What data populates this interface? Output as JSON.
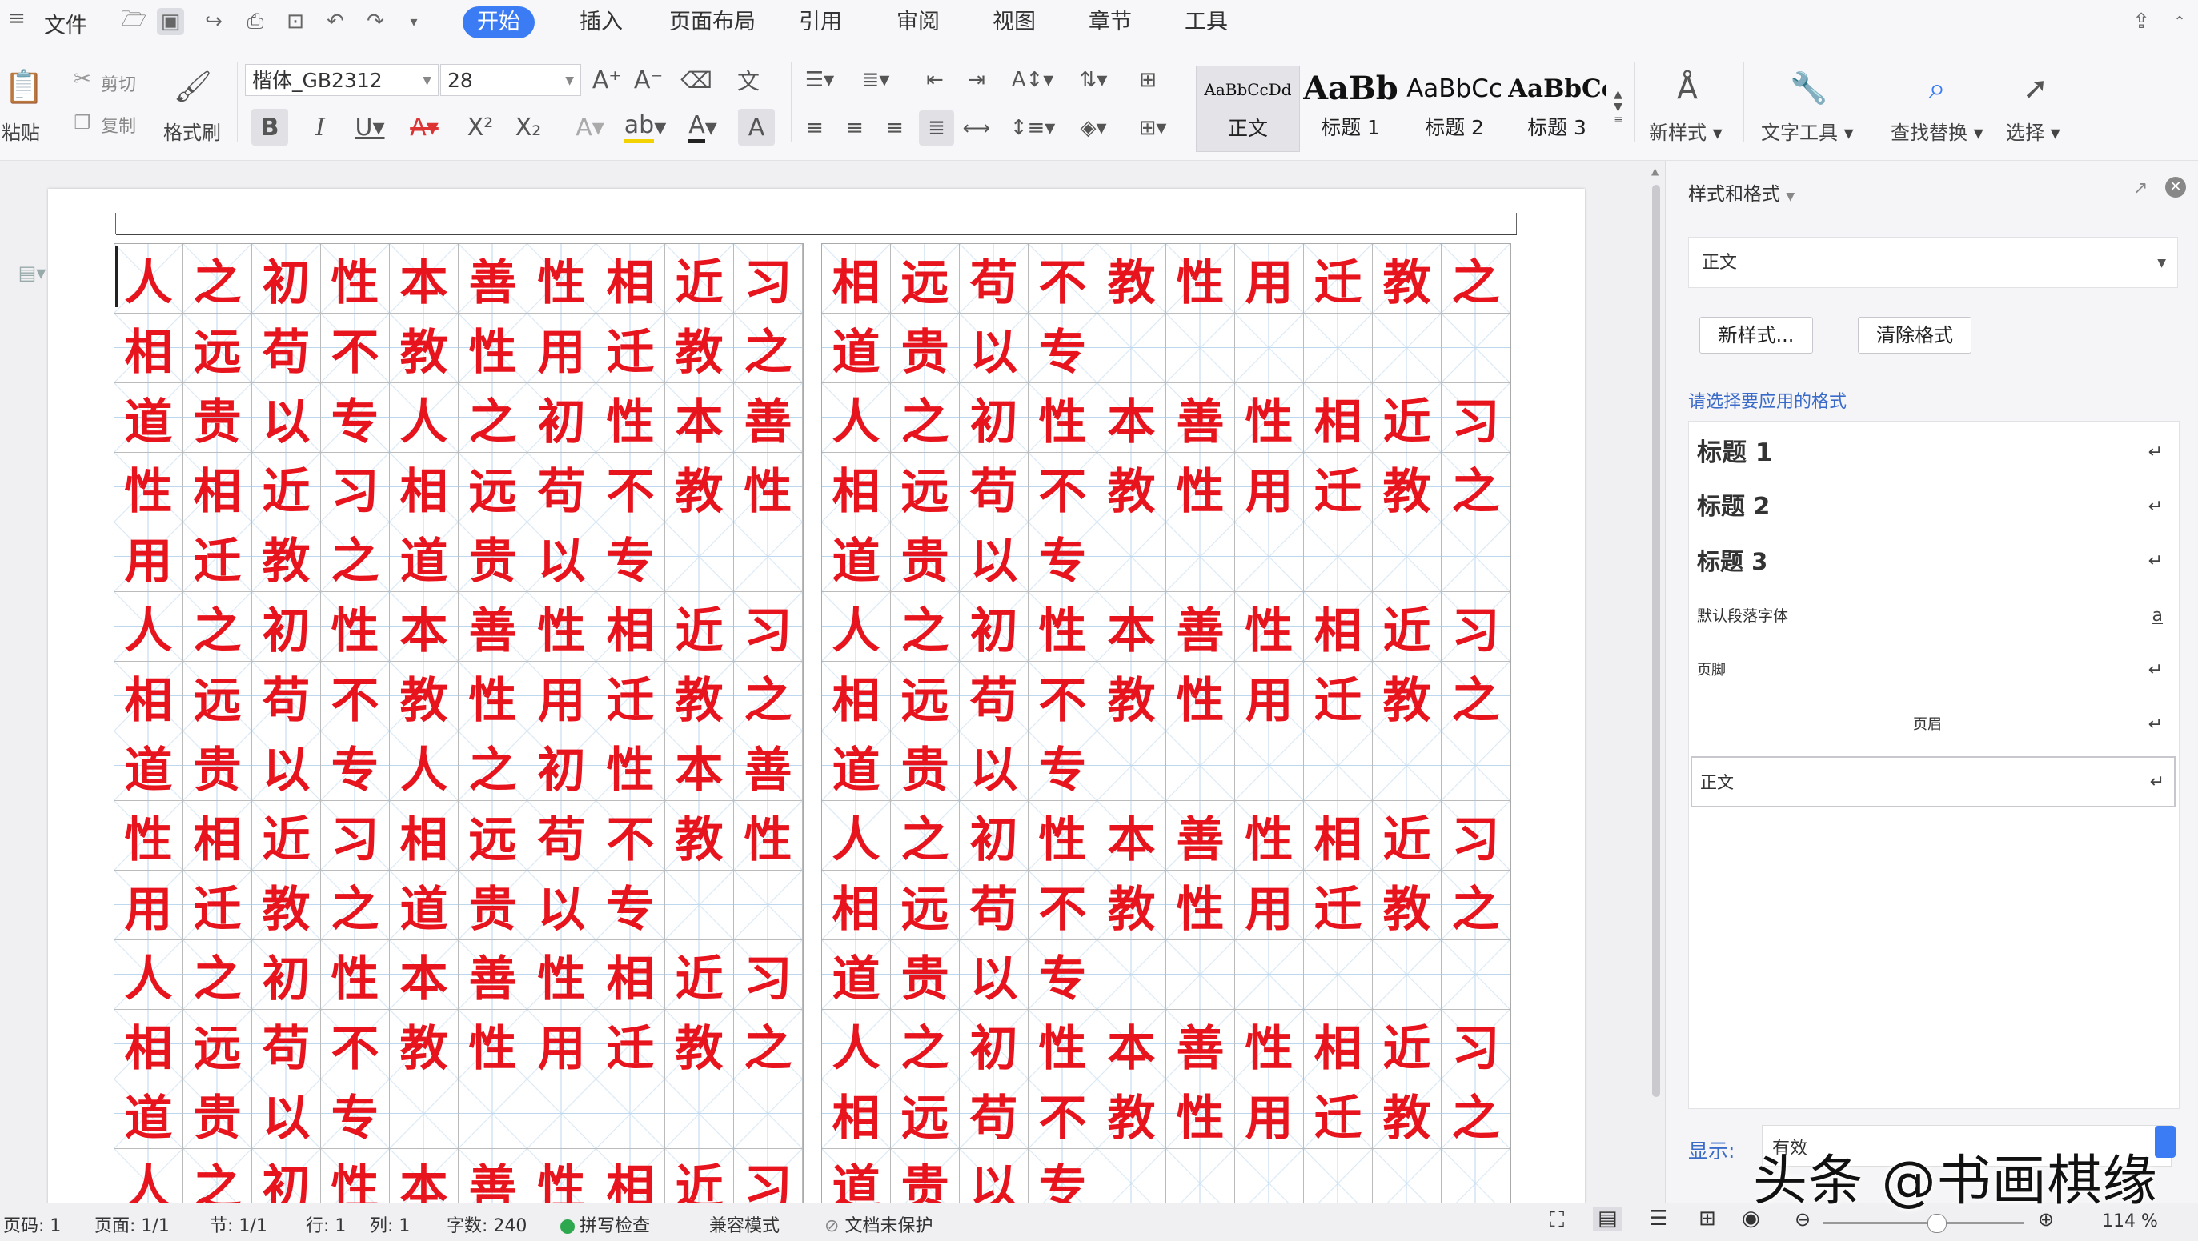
{
  "menu": {
    "file": "文件",
    "tabs": [
      {
        "label": "开始",
        "active": true
      },
      {
        "label": "插入",
        "active": false
      },
      {
        "label": "页面布局",
        "active": false
      },
      {
        "label": "引用",
        "active": false
      },
      {
        "label": "审阅",
        "active": false
      },
      {
        "label": "视图",
        "active": false
      },
      {
        "label": "章节",
        "active": false
      },
      {
        "label": "工具",
        "active": false
      }
    ]
  },
  "ribbon": {
    "paste": "粘贴",
    "cut": "剪切",
    "copy": "复制",
    "format_painter": "格式刷",
    "font_name": "楷体_GB2312",
    "font_size": "28",
    "styles": [
      {
        "sample": "AaBbCcDd",
        "label": "正文"
      },
      {
        "sample": "AaBb(",
        "label": "标题 1"
      },
      {
        "sample": "AaBbCc",
        "label": "标题 2"
      },
      {
        "sample": "AaBbCc",
        "label": "标题 3"
      }
    ],
    "new_style": "新样式",
    "text_tools": "文字工具",
    "find_replace": "查找替换",
    "select": "选择"
  },
  "document": {
    "left_grid": [
      "人之初性本善性相近习",
      "相远苟不教性用迁教之",
      "道贵以专人之初性本善",
      "性相近习相远苟不教性",
      "用迁教之道贵以专",
      "人之初性本善性相近习",
      "相远苟不教性用迁教之",
      "道贵以专人之初性本善",
      "性相近习相远苟不教性",
      "用迁教之道贵以专",
      "人之初性本善性相近习",
      "相远苟不教性用迁教之",
      "道贵以专",
      "人之初性本善性相近习"
    ],
    "right_grid": [
      "相远苟不教性用迁教之",
      "道贵以专",
      "人之初性本善性相近习",
      "相远苟不教性用迁教之",
      "道贵以专",
      "人之初性本善性相近习",
      "相远苟不教性用迁教之",
      "道贵以专",
      "人之初性本善性相近习",
      "相远苟不教性用迁教之",
      "道贵以专",
      "人之初性本善性相近习",
      "相远苟不教性用迁教之",
      "道贵以专"
    ]
  },
  "pane": {
    "title": "样式和格式",
    "current_style": "正文",
    "new_style_btn": "新样式...",
    "clear_format_btn": "清除格式",
    "hint": "请选择要应用的格式",
    "styles": [
      {
        "name": "标题 1",
        "mark": "↵"
      },
      {
        "name": "标题 2",
        "mark": "↵"
      },
      {
        "name": "标题 3",
        "mark": "↵"
      },
      {
        "name": "默认段落字体",
        "mark": "a"
      },
      {
        "name": "页脚",
        "mark": "↵"
      },
      {
        "name": "页眉",
        "mark": "↵"
      },
      {
        "name": "正文",
        "mark": "↵"
      }
    ],
    "show_label": "显示:",
    "show_value": "有效"
  },
  "status": {
    "page_no": "页码: 1",
    "pages": "页面: 1/1",
    "section": "节: 1/1",
    "line": "行: 1",
    "column": "列: 1",
    "word_count": "字数: 240",
    "spell_check": "拼写检查",
    "compat_mode": "兼容模式",
    "doc_protect": "文档未保护",
    "zoom": "114 %"
  },
  "watermark": "头条 @书画棋缘",
  "colors": {
    "accent": "#3b7cf5",
    "glyph_red": "#e8141d",
    "grid_blue": "#bcd7ee"
  }
}
